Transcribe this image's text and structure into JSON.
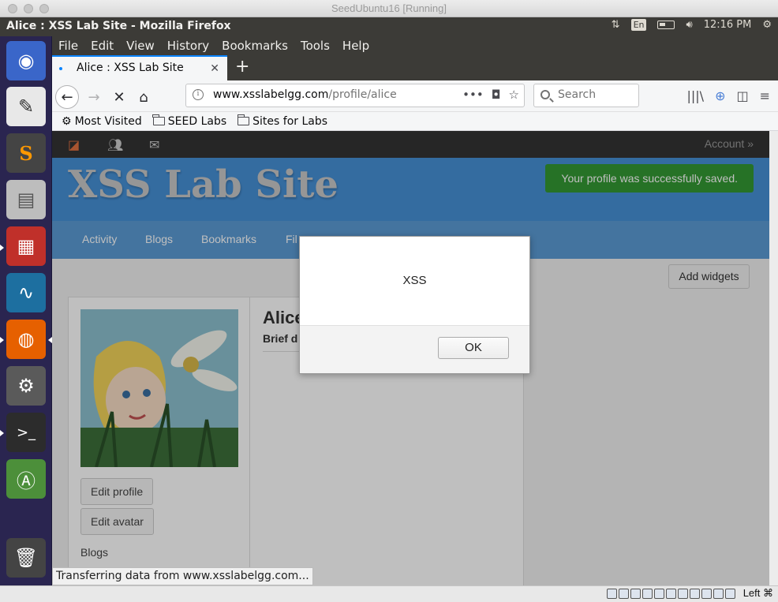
{
  "host": {
    "title": "SeedUbuntu16 [Running]"
  },
  "panel": {
    "window_title": "Alice : XSS Lab Site - Mozilla Firefox",
    "lang": "En",
    "time": "12:16 PM"
  },
  "launcher": {
    "items": [
      "ubuntu-dash-icon",
      "text-editor-icon",
      "sublime-text-icon",
      "file-manager-icon",
      "terminal-red-icon",
      "wireshark-icon",
      "firefox-icon",
      "system-settings-icon",
      "terminal-icon",
      "software-updater-icon",
      "trash-icon"
    ]
  },
  "menu": [
    "File",
    "Edit",
    "View",
    "History",
    "Bookmarks",
    "Tools",
    "Help"
  ],
  "tab": {
    "title": "Alice : XSS Lab Site"
  },
  "url": {
    "host": "www.xsslabelgg.com",
    "path": "/profile/alice"
  },
  "search": {
    "placeholder": "Search"
  },
  "bookmarks": [
    "Most Visited",
    "SEED Labs",
    "Sites for Labs"
  ],
  "site": {
    "account": "Account »",
    "title": "XSS Lab Site",
    "success": "Your profile was successfully saved.",
    "nav": [
      "Activity",
      "Blogs",
      "Bookmarks",
      "Fil"
    ],
    "add_widgets": "Add widgets",
    "profile_name": "Alice",
    "brief": "Brief d",
    "edit_profile": "Edit profile",
    "edit_avatar": "Edit avatar",
    "blogs": "Blogs"
  },
  "dialog": {
    "message": "XSS",
    "ok": "OK"
  },
  "status": {
    "transfer": "Transferring data from www.xsslabelgg.com..."
  },
  "vbox": {
    "host_key": "Left ⌘"
  },
  "colors": {
    "accent": "#0a84ff",
    "header": "#4690d6",
    "success": "#339933",
    "launcher": "#2a2550"
  }
}
